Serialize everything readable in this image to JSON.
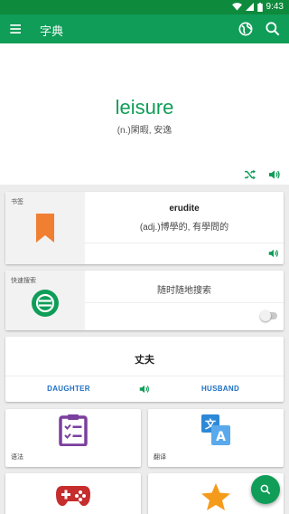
{
  "status_bar": {
    "time": "9:43"
  },
  "app_bar": {
    "title": "字典",
    "icons": [
      "menu-icon",
      "globe-icon",
      "search-icon"
    ]
  },
  "hero": {
    "word": "leisure",
    "definition": "(n.)閑暇, 安逸"
  },
  "bookmark_card": {
    "label": "书签",
    "word": "erudite",
    "definition": "(adj.)博學的, 有學問的"
  },
  "quick_search_card": {
    "label": "快速搜索",
    "text": "随时随地搜索",
    "toggle_on": false
  },
  "word_card": {
    "word": "丈夫",
    "left_button": "DAUGHTER",
    "right_button": "HUSBAND"
  },
  "tiles": [
    {
      "label": "语法",
      "icon": "clipboard-check-icon"
    },
    {
      "label": "翻译",
      "icon": "translate-icon"
    },
    {
      "label": "",
      "icon": "gamepad-icon"
    },
    {
      "label": "",
      "icon": "star-icon"
    }
  ],
  "colors": {
    "primary": "#0f9d58",
    "status_bar": "#0e8a3c",
    "link_blue": "#1e6fc3",
    "bookmark_orange": "#f07f32",
    "grammar_purple": "#7b3f9e",
    "translate_blue": "#2d88d8",
    "game_red": "#c62d2d",
    "star_orange": "#f59b1c"
  }
}
